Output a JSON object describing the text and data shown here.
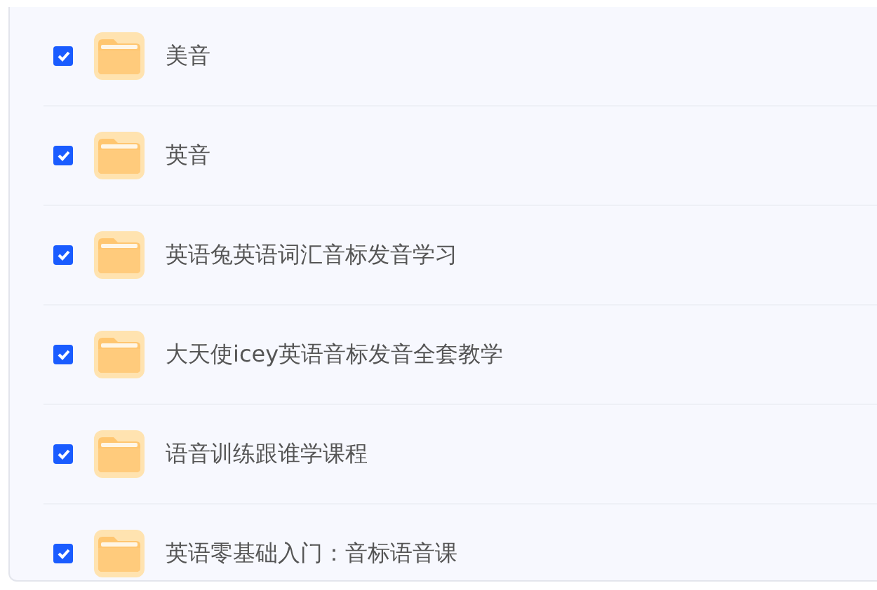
{
  "folders": [
    {
      "name": "美音",
      "checked": true
    },
    {
      "name": "英音",
      "checked": true
    },
    {
      "name": "英语兔英语词汇音标发音学习",
      "checked": true
    },
    {
      "name": "大天使icey英语音标发音全套教学",
      "checked": true
    },
    {
      "name": "语音训练跟谁学课程",
      "checked": true
    },
    {
      "name": "英语零基础入门：音标语音课",
      "checked": true
    }
  ]
}
